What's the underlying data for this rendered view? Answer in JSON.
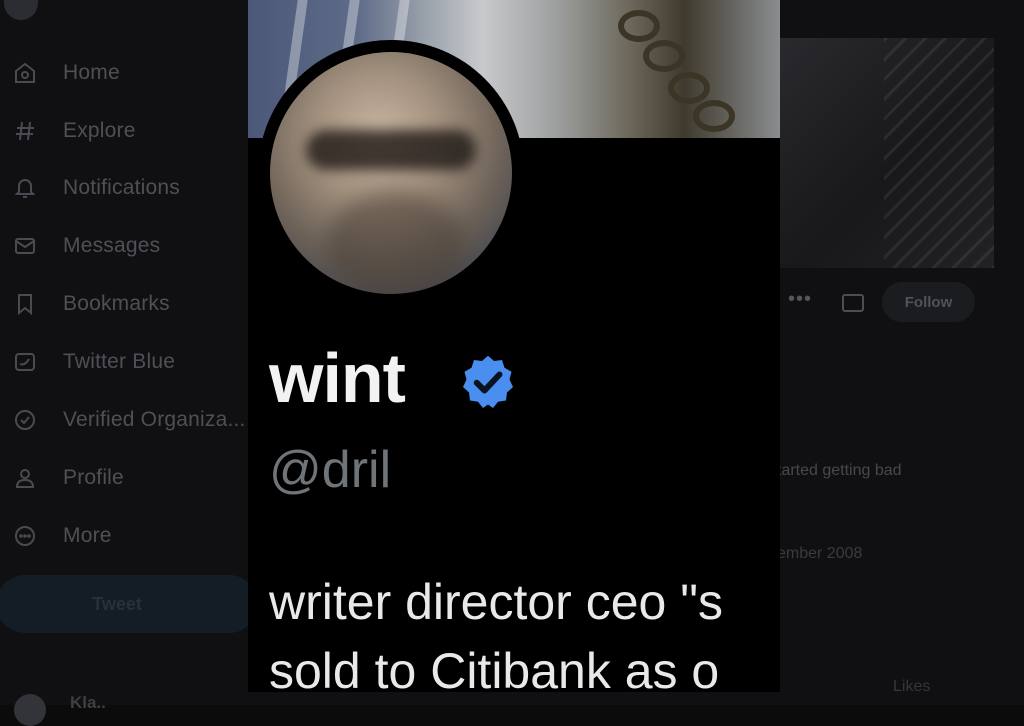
{
  "sidebar": {
    "items": [
      {
        "label": "Home",
        "icon": "home-icon"
      },
      {
        "label": "Explore",
        "icon": "hashtag-icon"
      },
      {
        "label": "Notifications",
        "icon": "bell-icon"
      },
      {
        "label": "Messages",
        "icon": "envelope-icon"
      },
      {
        "label": "Bookmarks",
        "icon": "bookmark-icon"
      },
      {
        "label": "Twitter Blue",
        "icon": "twitter-blue-icon"
      },
      {
        "label": "Verified Organiza...",
        "icon": "verified-org-icon"
      },
      {
        "label": "Profile",
        "icon": "person-icon"
      },
      {
        "label": "More",
        "icon": "more-circle-icon"
      }
    ],
    "tweet_label": "Tweet",
    "account_name": "Kla.."
  },
  "profile_bg": {
    "follow_label": "Follow",
    "bio_fragment": "tarted getting bad",
    "joined_fragment": "ember 2008",
    "likes_tab": "Likes"
  },
  "card": {
    "name": "wint",
    "handle": "@dril",
    "bio_line1": "writer director ceo \"s",
    "bio_line2": "sold to Citibank as o"
  },
  "colors": {
    "verified_blue": "#4a8ff0",
    "background": "#000000"
  }
}
